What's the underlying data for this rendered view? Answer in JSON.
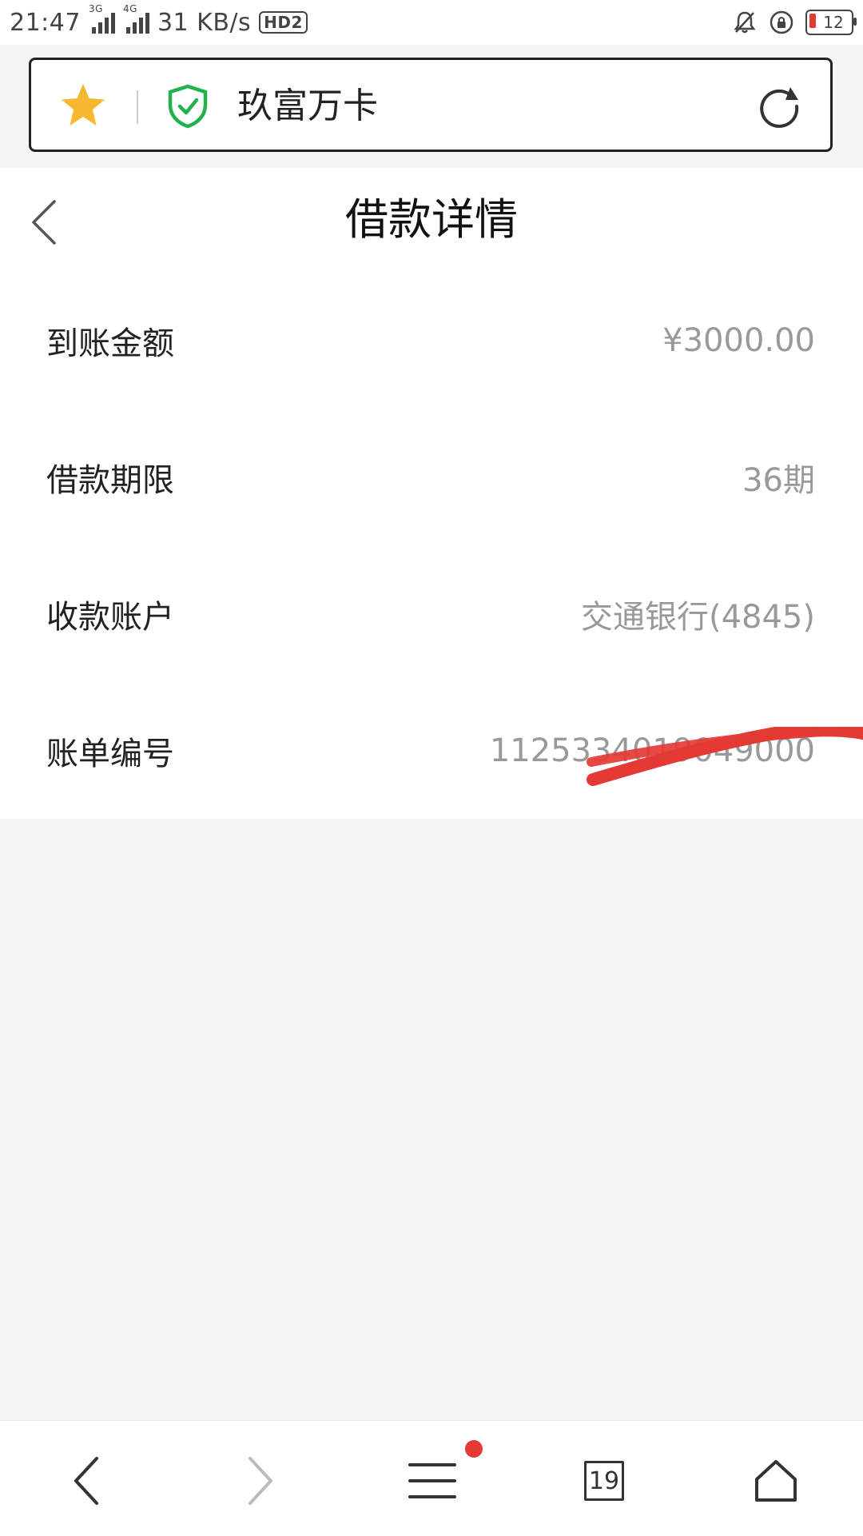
{
  "status_bar": {
    "time": "21:47",
    "net1": "3G",
    "net2": "4G",
    "speed": "31 KB/s",
    "hd": "HD2",
    "battery": "12"
  },
  "address_bar": {
    "title": "玖富万卡"
  },
  "page": {
    "title": "借款详情"
  },
  "details": [
    {
      "label": "到账金额",
      "value": "¥3000.00"
    },
    {
      "label": "借款期限",
      "value": "36期"
    },
    {
      "label": "收款账户",
      "value": "交通银行(4845)"
    },
    {
      "label": "账单编号",
      "value": "1125334019049000"
    }
  ],
  "bottom_nav": {
    "tab_count": "19"
  },
  "colors": {
    "accent_star": "#f5b82e",
    "shield_green": "#22b24c",
    "scribble_red": "#e53935",
    "value_gray": "#999999"
  }
}
